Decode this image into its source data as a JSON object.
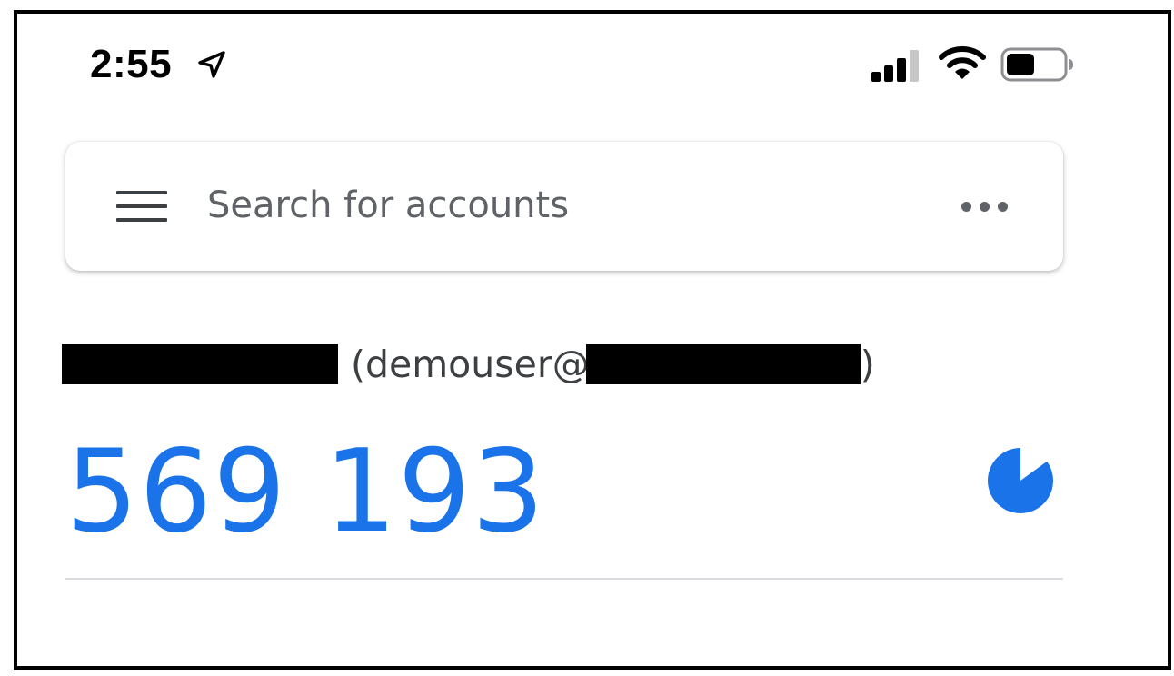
{
  "status_bar": {
    "time": "2:55",
    "icons": [
      "location-arrow-icon",
      "cellular-signal-icon",
      "wifi-icon",
      "battery-icon"
    ],
    "battery_level": 0.5
  },
  "search": {
    "placeholder": "Search for accounts",
    "value": "",
    "menu_icon": "hamburger-menu-icon",
    "more_icon": "more-horizontal-icon"
  },
  "accounts": [
    {
      "label_prefix": "(demouser@",
      "label_suffix": ")",
      "code": "569 193",
      "timer_icon": "countdown-timer-icon",
      "timer_remaining_fraction": 0.85
    }
  ],
  "colors": {
    "accent": "#1a73e8",
    "text_secondary": "#5f6368",
    "divider": "#dadce0"
  }
}
